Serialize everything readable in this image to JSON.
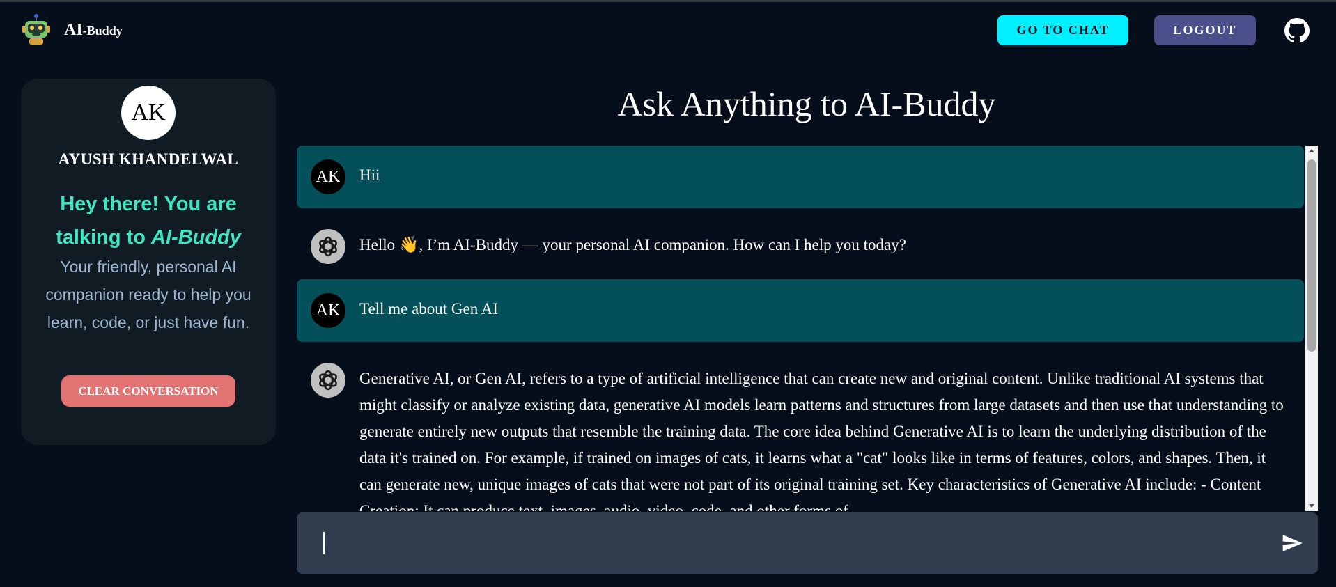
{
  "navbar": {
    "brand_main": "AI",
    "brand_small": "-Buddy",
    "go_to_chat_label": "GO TO CHAT",
    "logout_label": "LOGOUT",
    "logo_icon": "robot-icon",
    "github_icon": "github-icon"
  },
  "sidebar": {
    "avatar_initials": "AK",
    "user_name": "AYUSH KHANDELWAL",
    "greeting_prefix": "Hey there! You are talking to ",
    "greeting_emphasis": "AI-Buddy",
    "tagline": "Your friendly, personal AI companion ready to help you learn, code, or just have fun.",
    "clear_label": "CLEAR CONVERSATION"
  },
  "main": {
    "title": "Ask Anything to AI-Buddy",
    "messages": [
      {
        "role": "user",
        "avatar": "AK",
        "text": "Hii"
      },
      {
        "role": "bot",
        "avatar_icon": "openai-icon",
        "text": "Hello 👋, I’m AI-Buddy — your personal AI companion. How can I help you today?"
      },
      {
        "role": "user",
        "avatar": "AK",
        "text": "Tell me about Gen AI"
      },
      {
        "role": "bot",
        "avatar_icon": "openai-icon",
        "text": "Generative AI, or Gen AI, refers to a type of artificial intelligence that can create new and original content. Unlike traditional AI systems that might classify or analyze existing data, generative AI models learn patterns and structures from large datasets and then use that understanding to generate entirely new outputs that resemble the training data. The core idea behind Generative AI is to learn the underlying distribution of the data it's trained on. For example, if trained on images of cats, it learns what a \"cat\" looks like in terms of features, colors, and shapes. Then, it can generate new, unique images of cats that were not part of its original training set. Key characteristics of Generative AI include: - Content Creation: It can produce text, images, audio, video, code, and other forms of"
      }
    ],
    "input_value": "",
    "send_icon": "send-icon"
  },
  "colors": {
    "background": "#070e1b",
    "accent_cyan": "#00f0ff",
    "logout": "#4b4f8c",
    "user_bubble": "#03505a",
    "greeting": "#3ee6c2",
    "clear_button": "#e47373",
    "input_bar": "#2f3d4f"
  }
}
